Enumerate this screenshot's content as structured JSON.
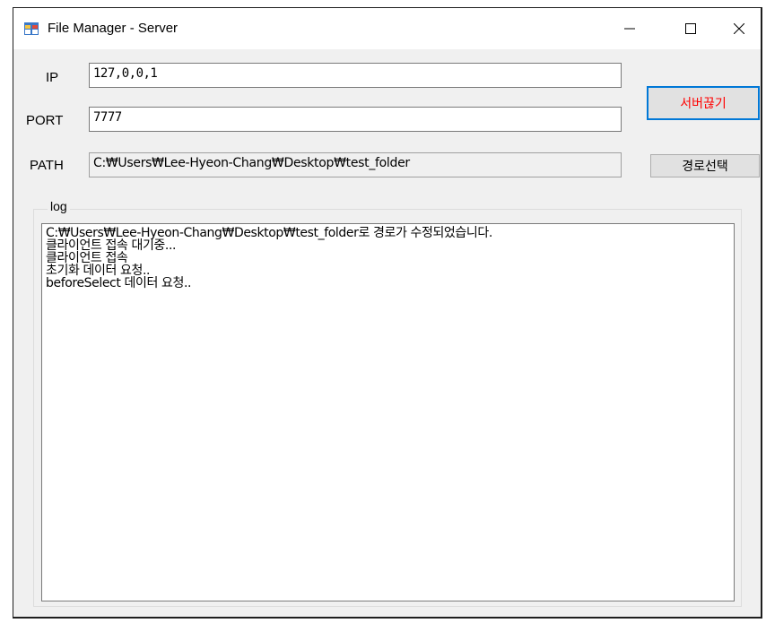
{
  "window": {
    "title": "File Manager - Server",
    "accent_color": "#0078d7"
  },
  "form": {
    "ip_label": "IP",
    "ip_value": "127,0,0,1",
    "port_label": "PORT",
    "port_value": "7777",
    "path_label": "PATH",
    "path_value": "C:₩Users₩Lee-Hyeon-Chang₩Desktop₩test_folder"
  },
  "buttons": {
    "disconnect_label": "서버끊기",
    "disconnect_color": "#ff0000",
    "select_path_label": "경로선택"
  },
  "log": {
    "title": "log",
    "lines": [
      "C:₩Users₩Lee-Hyeon-Chang₩Desktop₩test_folder로 경로가 수정되었습니다.",
      "클라이언트 접속 대기중...",
      "클라이언트 접속",
      "초기화 데이터 요청..",
      "beforeSelect 데이터 요청.."
    ]
  }
}
